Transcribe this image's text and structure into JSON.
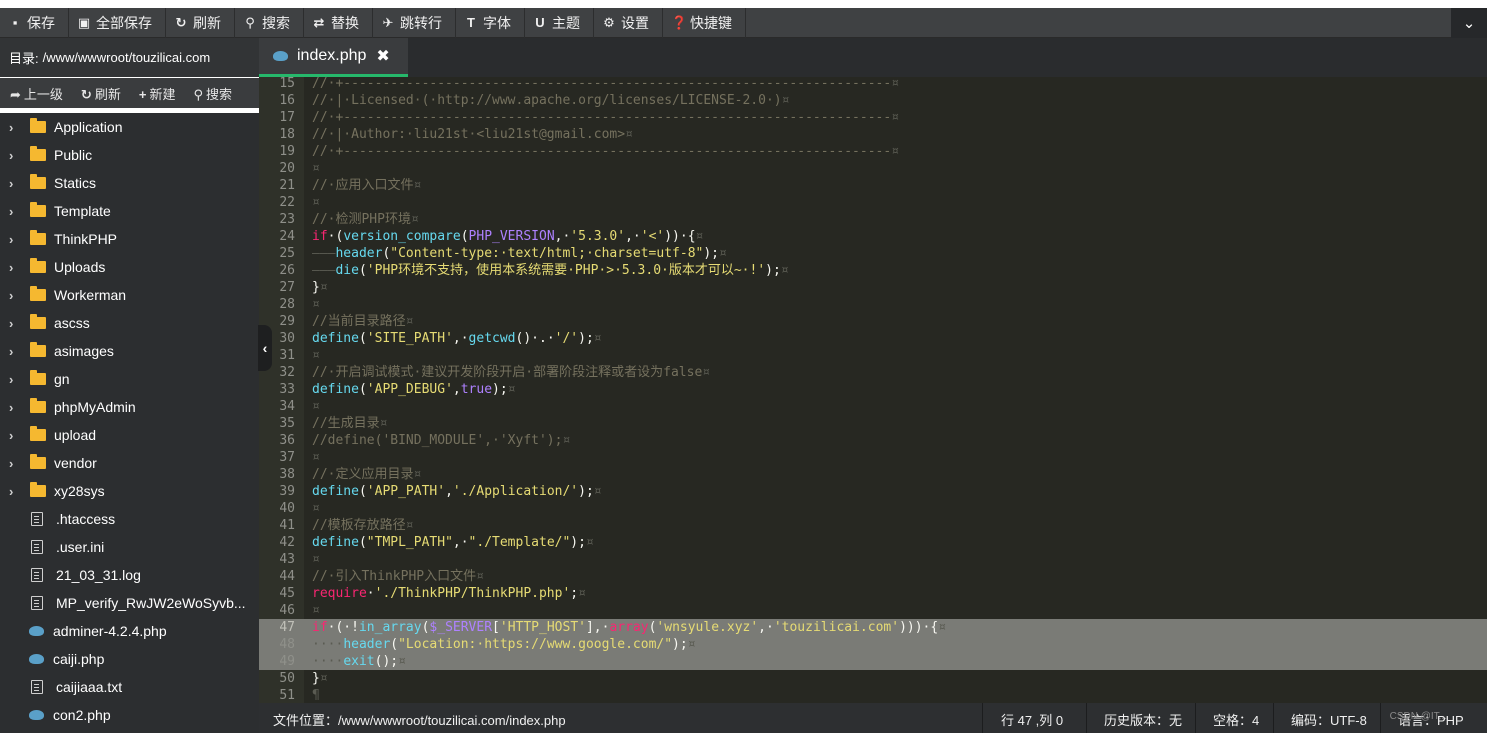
{
  "toolbar": {
    "buttons": [
      {
        "label": "保存",
        "icon": "save-icon",
        "glyph": "▪"
      },
      {
        "label": "全部保存",
        "icon": "save-all-icon",
        "glyph": "▣"
      },
      {
        "label": "刷新",
        "icon": "refresh-icon",
        "glyph": "↻"
      },
      {
        "label": "搜索",
        "icon": "search-icon",
        "glyph": "⚲"
      },
      {
        "label": "替换",
        "icon": "replace-icon",
        "glyph": "⇄"
      },
      {
        "label": "跳转行",
        "icon": "goto-line-icon",
        "glyph": "✈"
      },
      {
        "label": "字体",
        "icon": "font-icon",
        "glyph": "T"
      },
      {
        "label": "主题",
        "icon": "theme-icon",
        "glyph": "U"
      },
      {
        "label": "设置",
        "icon": "gear-icon",
        "glyph": "⚙"
      },
      {
        "label": "快捷键",
        "icon": "help-icon",
        "glyph": "❓"
      }
    ],
    "collapse_glyph": "⌄"
  },
  "sidebar": {
    "directory_label": "目录:",
    "directory_path": "/www/wwwroot/touzilicai.com",
    "actions": [
      {
        "label": "上一级",
        "icon": "share-icon",
        "glyph": "➦"
      },
      {
        "label": "刷新",
        "icon": "refresh-icon",
        "glyph": "↻"
      },
      {
        "label": "新建",
        "icon": "plus-icon",
        "glyph": "+"
      },
      {
        "label": "搜索",
        "icon": "search-icon",
        "glyph": "⚲"
      }
    ],
    "tree": [
      {
        "name": "Application",
        "type": "folder"
      },
      {
        "name": "Public",
        "type": "folder"
      },
      {
        "name": "Statics",
        "type": "folder"
      },
      {
        "name": "Template",
        "type": "folder"
      },
      {
        "name": "ThinkPHP",
        "type": "folder"
      },
      {
        "name": "Uploads",
        "type": "folder"
      },
      {
        "name": "Workerman",
        "type": "folder"
      },
      {
        "name": "ascss",
        "type": "folder"
      },
      {
        "name": "asimages",
        "type": "folder"
      },
      {
        "name": "gn",
        "type": "folder"
      },
      {
        "name": "phpMyAdmin",
        "type": "folder"
      },
      {
        "name": "upload",
        "type": "folder"
      },
      {
        "name": "vendor",
        "type": "folder"
      },
      {
        "name": "xy28sys",
        "type": "folder"
      },
      {
        "name": ".htaccess",
        "type": "file"
      },
      {
        "name": ".user.ini",
        "type": "file"
      },
      {
        "name": "21_03_31.log",
        "type": "file"
      },
      {
        "name": "MP_verify_RwJW2eWoSyvb...",
        "type": "file"
      },
      {
        "name": "adminer-4.2.4.php",
        "type": "php"
      },
      {
        "name": "caiji.php",
        "type": "php"
      },
      {
        "name": "caijiaaa.txt",
        "type": "file"
      },
      {
        "name": "con2.php",
        "type": "php"
      }
    ]
  },
  "editor": {
    "tab": {
      "label": "index.php",
      "close": "✖"
    },
    "collapse_glyph": "‹",
    "selected_lines": [
      47,
      48,
      49
    ],
    "cursor_line": 47,
    "lines": [
      {
        "n": "15",
        "t": [
          [
            "c",
            "//·+----------------------------------------------------------------------"
          ],
          [
            "ws",
            "¤"
          ]
        ]
      },
      {
        "n": "16",
        "t": [
          [
            "c",
            "//·|·Licensed·(·http://www.apache.org/licenses/LICENSE-2.0·)"
          ],
          [
            "ws",
            "¤"
          ]
        ]
      },
      {
        "n": "17",
        "t": [
          [
            "c",
            "//·+----------------------------------------------------------------------"
          ],
          [
            "ws",
            "¤"
          ]
        ]
      },
      {
        "n": "18",
        "t": [
          [
            "c",
            "//·|·Author:·liu21st·<liu21st@gmail.com>"
          ],
          [
            "ws",
            "¤"
          ]
        ]
      },
      {
        "n": "19",
        "t": [
          [
            "c",
            "//·+----------------------------------------------------------------------"
          ],
          [
            "ws",
            "¤"
          ]
        ]
      },
      {
        "n": "20",
        "t": [
          [
            "ws",
            "¤"
          ]
        ]
      },
      {
        "n": "21",
        "t": [
          [
            "c",
            "//·应用入口文件"
          ],
          [
            "ws",
            "¤"
          ]
        ]
      },
      {
        "n": "22",
        "t": [
          [
            "ws",
            "¤"
          ]
        ]
      },
      {
        "n": "23",
        "t": [
          [
            "c",
            "//·检测PHP环境"
          ],
          [
            "ws",
            "¤"
          ]
        ]
      },
      {
        "n": "24",
        "t": [
          [
            "k",
            "if"
          ],
          [
            "p",
            "·("
          ],
          [
            "f",
            "version_compare"
          ],
          [
            "p",
            "("
          ],
          [
            "v",
            "PHP_VERSION"
          ],
          [
            "p",
            ",·"
          ],
          [
            "s",
            "'5.3.0'"
          ],
          [
            "p",
            ",·"
          ],
          [
            "s",
            "'<'"
          ],
          [
            "p",
            "))·{"
          ],
          [
            "ws",
            "¤"
          ]
        ]
      },
      {
        "n": "25",
        "t": [
          [
            "ws",
            "———"
          ],
          [
            "f",
            "header"
          ],
          [
            "p",
            "("
          ],
          [
            "s",
            "\"Content-type:·text/html;·charset=utf-8\""
          ],
          [
            "p",
            ");"
          ],
          [
            "ws",
            "¤"
          ]
        ]
      },
      {
        "n": "26",
        "t": [
          [
            "ws",
            "———"
          ],
          [
            "f",
            "die"
          ],
          [
            "p",
            "("
          ],
          [
            "s",
            "'PHP环境不支持，使用本系统需要·PHP·>·5.3.0·版本才可以~·!'"
          ],
          [
            "p",
            ");"
          ],
          [
            "ws",
            "¤"
          ]
        ]
      },
      {
        "n": "27",
        "t": [
          [
            "p",
            "}"
          ],
          [
            "ws",
            "¤"
          ]
        ]
      },
      {
        "n": "28",
        "t": [
          [
            "ws",
            "¤"
          ]
        ]
      },
      {
        "n": "29",
        "t": [
          [
            "c",
            "//当前目录路径"
          ],
          [
            "ws",
            "¤"
          ]
        ]
      },
      {
        "n": "30",
        "t": [
          [
            "f",
            "define"
          ],
          [
            "p",
            "("
          ],
          [
            "s",
            "'SITE_PATH'"
          ],
          [
            "p",
            ",·"
          ],
          [
            "f",
            "getcwd"
          ],
          [
            "p",
            "()·.·"
          ],
          [
            "s",
            "'/'"
          ],
          [
            "p",
            ");"
          ],
          [
            "ws",
            "¤"
          ]
        ]
      },
      {
        "n": "31",
        "t": [
          [
            "ws",
            "¤"
          ]
        ]
      },
      {
        "n": "32",
        "t": [
          [
            "c",
            "//·开启调试模式·建议开发阶段开启·部署阶段注释或者设为false"
          ],
          [
            "ws",
            "¤"
          ]
        ]
      },
      {
        "n": "33",
        "t": [
          [
            "f",
            "define"
          ],
          [
            "p",
            "("
          ],
          [
            "s",
            "'APP_DEBUG'"
          ],
          [
            "p",
            ","
          ],
          [
            "v",
            "true"
          ],
          [
            "p",
            ");"
          ],
          [
            "ws",
            "¤"
          ]
        ]
      },
      {
        "n": "34",
        "t": [
          [
            "ws",
            "¤"
          ]
        ]
      },
      {
        "n": "35",
        "t": [
          [
            "c",
            "//生成目录"
          ],
          [
            "ws",
            "¤"
          ]
        ]
      },
      {
        "n": "36",
        "t": [
          [
            "c",
            "//define('BIND_MODULE',·'Xyft');"
          ],
          [
            "ws",
            "¤"
          ]
        ]
      },
      {
        "n": "37",
        "t": [
          [
            "ws",
            "¤"
          ]
        ]
      },
      {
        "n": "38",
        "t": [
          [
            "c",
            "//·定义应用目录"
          ],
          [
            "ws",
            "¤"
          ]
        ]
      },
      {
        "n": "39",
        "t": [
          [
            "f",
            "define"
          ],
          [
            "p",
            "("
          ],
          [
            "s",
            "'APP_PATH'"
          ],
          [
            "p",
            ","
          ],
          [
            "s",
            "'./Application/'"
          ],
          [
            "p",
            ");"
          ],
          [
            "ws",
            "¤"
          ]
        ]
      },
      {
        "n": "40",
        "t": [
          [
            "ws",
            "¤"
          ]
        ]
      },
      {
        "n": "41",
        "t": [
          [
            "c",
            "//模板存放路径"
          ],
          [
            "ws",
            "¤"
          ]
        ]
      },
      {
        "n": "42",
        "t": [
          [
            "f",
            "define"
          ],
          [
            "p",
            "("
          ],
          [
            "s",
            "\"TMPL_PATH\""
          ],
          [
            "p",
            ",·"
          ],
          [
            "s",
            "\"./Template/\""
          ],
          [
            "p",
            ");"
          ],
          [
            "ws",
            "¤"
          ]
        ]
      },
      {
        "n": "43",
        "t": [
          [
            "ws",
            "¤"
          ]
        ]
      },
      {
        "n": "44",
        "t": [
          [
            "c",
            "//·引入ThinkPHP入口文件"
          ],
          [
            "ws",
            "¤"
          ]
        ]
      },
      {
        "n": "45",
        "t": [
          [
            "k",
            "require"
          ],
          [
            "p",
            "·"
          ],
          [
            "s",
            "'./ThinkPHP/ThinkPHP.php'"
          ],
          [
            "p",
            ";"
          ],
          [
            "ws",
            "¤"
          ]
        ]
      },
      {
        "n": "46",
        "t": [
          [
            "ws",
            "¤"
          ]
        ]
      },
      {
        "n": "47",
        "t": [
          [
            "k",
            "if"
          ],
          [
            "p",
            "·(·!"
          ],
          [
            "f",
            "in_array"
          ],
          [
            "p",
            "("
          ],
          [
            "v",
            "$_SERVER"
          ],
          [
            "p",
            "["
          ],
          [
            "s",
            "'HTTP_HOST'"
          ],
          [
            "p",
            "],·"
          ],
          [
            "k",
            "array"
          ],
          [
            "p",
            "("
          ],
          [
            "s",
            "'wnsyule.xyz'"
          ],
          [
            "p",
            ",·"
          ],
          [
            "s",
            "'touzilicai.com'"
          ],
          [
            "p",
            ")))·{"
          ],
          [
            "ws",
            "¤"
          ]
        ]
      },
      {
        "n": "48",
        "t": [
          [
            "ws",
            "····"
          ],
          [
            "f",
            "header"
          ],
          [
            "p",
            "("
          ],
          [
            "s",
            "\"Location:·https://www.google.com/\""
          ],
          [
            "p",
            ");"
          ],
          [
            "ws",
            "¤"
          ]
        ]
      },
      {
        "n": "49",
        "t": [
          [
            "ws",
            "····"
          ],
          [
            "f",
            "exit"
          ],
          [
            "p",
            "();"
          ],
          [
            "ws",
            "¤"
          ]
        ]
      },
      {
        "n": "50",
        "t": [
          [
            "p",
            "}"
          ],
          [
            "ws",
            "¤"
          ]
        ]
      },
      {
        "n": "51",
        "t": [
          [
            "ws",
            "¶"
          ]
        ]
      }
    ]
  },
  "statusbar": {
    "file_location": "文件位置：/www/wwwroot/touzilicai.com/index.php",
    "position": "行 47 ,列 0",
    "history": "历史版本：无",
    "spaces": "空格：4",
    "encoding": "编码：UTF-8",
    "language": "语言：PHP",
    "watermark": "CSDN @IT..."
  }
}
